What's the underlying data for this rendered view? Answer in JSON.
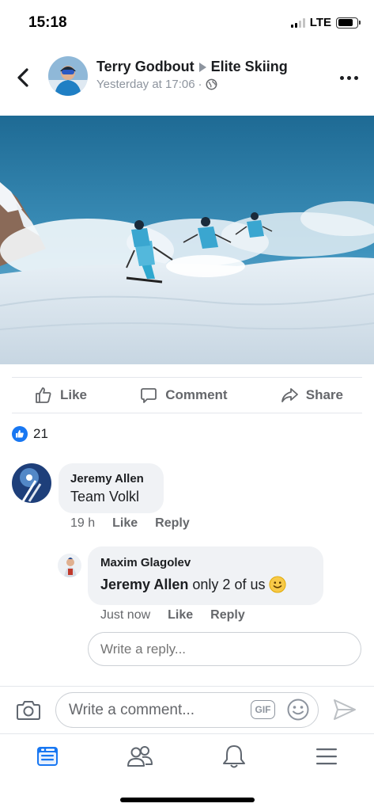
{
  "status_bar": {
    "time": "15:18",
    "network": "LTE",
    "signal_bars": 2,
    "battery_level": 0.8
  },
  "post": {
    "author": "Terry Godbout",
    "group": "Elite Skiing",
    "timestamp": "Yesterday at 17:06",
    "privacy_icon": "globe-icon",
    "photo_description_icon": "ski-photo"
  },
  "actions": {
    "like": "Like",
    "comment": "Comment",
    "share": "Share"
  },
  "reactions": {
    "count": "21",
    "type": "like"
  },
  "comments": [
    {
      "name": "Jeremy Allen",
      "text": "Team Volkl",
      "time": "19 h",
      "like_label": "Like",
      "reply_label": "Reply"
    }
  ],
  "replies": [
    {
      "name": "Maxim Glagolev",
      "mention": "Jeremy Allen",
      "text": "only 2 of us",
      "emoji": "slightly-smiling-face",
      "time": "Just now",
      "like_label": "Like",
      "reply_label": "Reply"
    }
  ],
  "reply_input": {
    "placeholder": "Write a reply..."
  },
  "compose": {
    "placeholder": "Write a comment...",
    "gif_label": "GIF"
  },
  "nav": {
    "items": [
      "news-feed",
      "friends",
      "notifications",
      "menu"
    ],
    "active": "news-feed"
  },
  "colors": {
    "brand_blue": "#1877f2",
    "secondary_text": "#65676b",
    "bubble_bg": "#f0f2f5"
  }
}
